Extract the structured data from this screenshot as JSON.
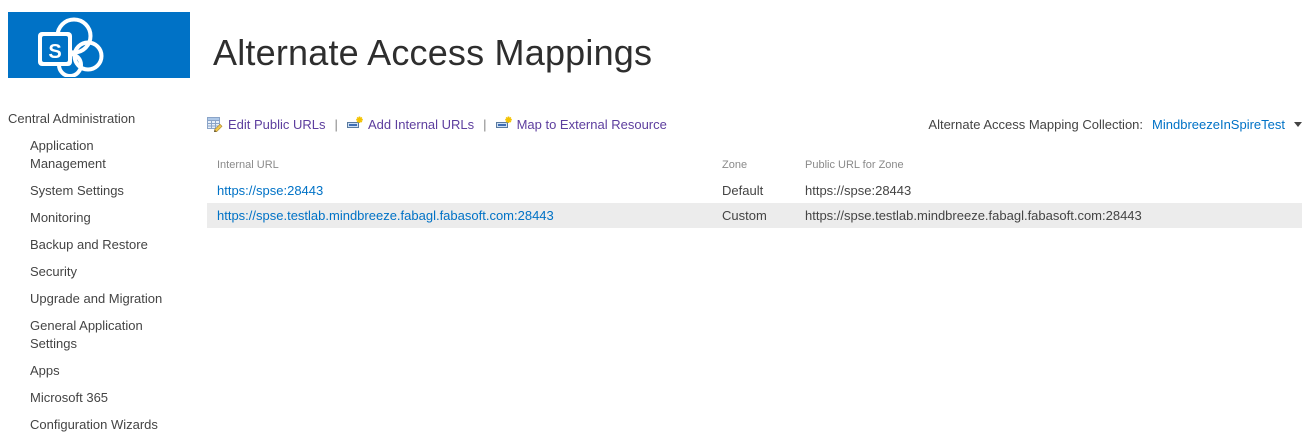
{
  "header": {
    "title": "Alternate Access Mappings",
    "logo_letter": "S"
  },
  "sidebar": {
    "root_label": "Central Administration",
    "items": [
      {
        "label": "Application Management"
      },
      {
        "label": "System Settings"
      },
      {
        "label": "Monitoring"
      },
      {
        "label": "Backup and Restore"
      },
      {
        "label": "Security"
      },
      {
        "label": "Upgrade and Migration"
      },
      {
        "label": "General Application Settings"
      },
      {
        "label": "Apps"
      },
      {
        "label": "Microsoft 365"
      },
      {
        "label": "Configuration Wizards"
      }
    ]
  },
  "toolbar": {
    "separator": "|",
    "actions": [
      {
        "label": "Edit Public URLs",
        "icon": "edit-table-icon"
      },
      {
        "label": "Add Internal URLs",
        "icon": "add-url-icon"
      },
      {
        "label": "Map to External Resource",
        "icon": "map-external-resource-icon"
      }
    ],
    "collection": {
      "label": "Alternate Access Mapping Collection:",
      "value": "MindbreezeInSpireTest"
    }
  },
  "table": {
    "columns": [
      "Internal URL",
      "Zone",
      "Public URL for Zone"
    ],
    "rows": [
      {
        "internal_url": "https://spse:28443",
        "zone": "Default",
        "public_url": "https://spse:28443"
      },
      {
        "internal_url": "https://spse.testlab.mindbreeze.fabagl.fabasoft.com:28443",
        "zone": "Custom",
        "public_url": "https://spse.testlab.mindbreeze.fabagl.fabasoft.com:28443"
      }
    ]
  },
  "colors": {
    "brand_blue": "#0072C6",
    "link_blue": "#0072C6",
    "toolbar_link_purple": "#5D3E9E",
    "row_highlight_gray": "#ECECEC",
    "table_header_gray": "#8A8A8A",
    "body_text": "#444444"
  }
}
